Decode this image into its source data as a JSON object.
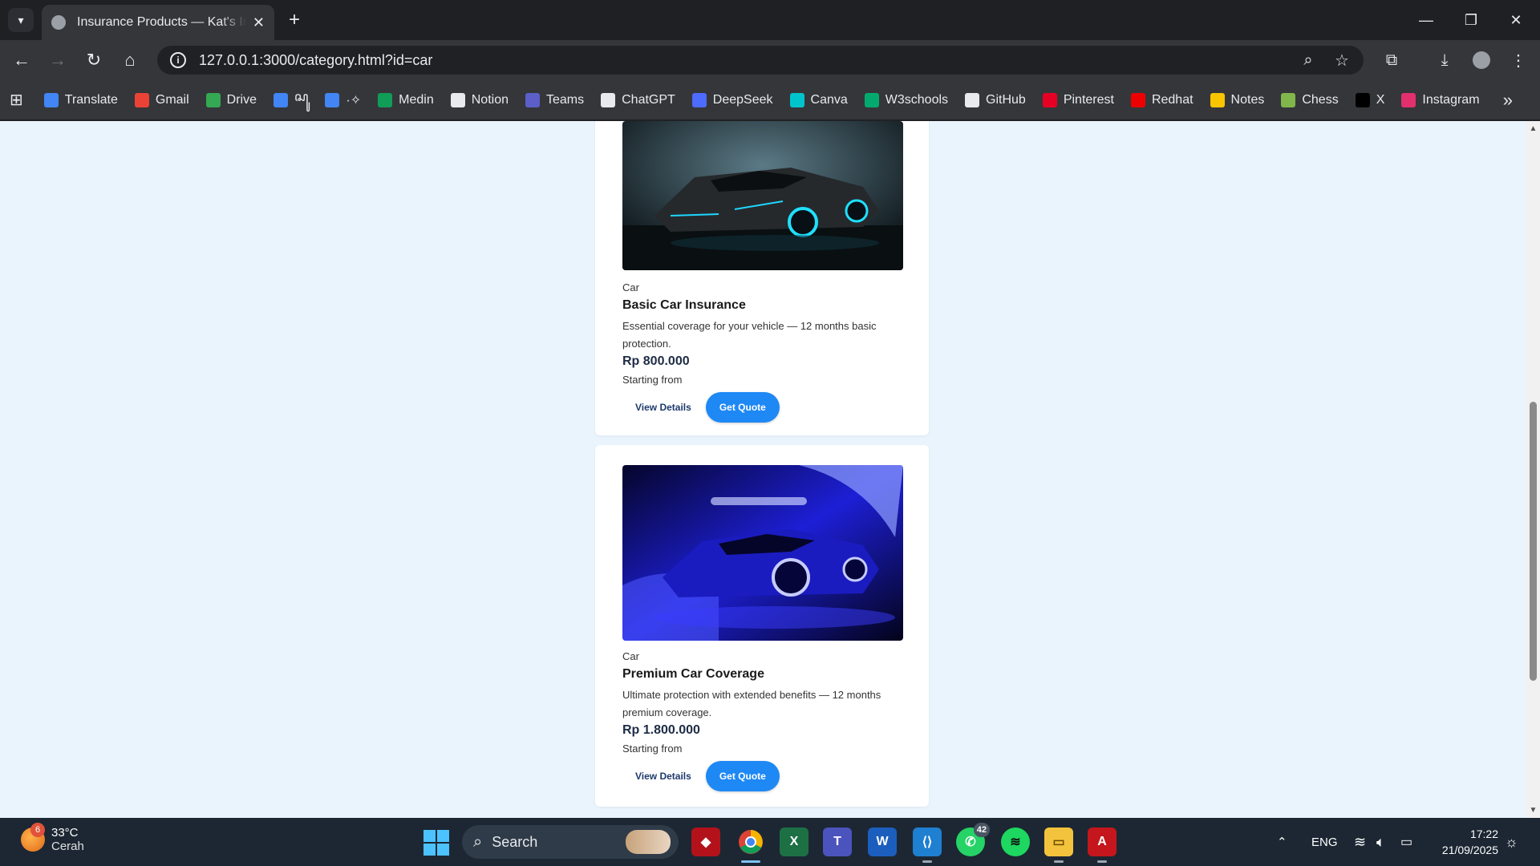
{
  "browser": {
    "tab_title": "Insurance Products — Kat's Insu",
    "url": "127.0.0.1:3000/category.html?id=car",
    "bookmarks": [
      {
        "label": "Translate",
        "icon": "translate-icon",
        "color": "#4285f4"
      },
      {
        "label": "Gmail",
        "icon": "gmail-icon",
        "color": "#ea4335"
      },
      {
        "label": "Drive",
        "icon": "drive-icon",
        "color": "#34a853"
      },
      {
        "label": "ꦱꦸ",
        "icon": "docs-icon",
        "color": "#4285f4"
      },
      {
        "label": "·✧",
        "icon": "docs-icon",
        "color": "#4285f4"
      },
      {
        "label": "Medin",
        "icon": "sheets-icon",
        "color": "#0f9d58"
      },
      {
        "label": "Notion",
        "icon": "notion-icon",
        "color": "#e8eaed"
      },
      {
        "label": "Teams",
        "icon": "teams-icon",
        "color": "#5b5fc7"
      },
      {
        "label": "ChatGPT",
        "icon": "chatgpt-icon",
        "color": "#e8eaed"
      },
      {
        "label": "DeepSeek",
        "icon": "deepseek-icon",
        "color": "#4d6bfe"
      },
      {
        "label": "Canva",
        "icon": "canva-icon",
        "color": "#00c4cc"
      },
      {
        "label": "W3schools",
        "icon": "w3schools-icon",
        "color": "#04aa6d"
      },
      {
        "label": "GitHub",
        "icon": "github-icon",
        "color": "#e8eaed"
      },
      {
        "label": "Pinterest",
        "icon": "pinterest-icon",
        "color": "#e60023"
      },
      {
        "label": "Redhat",
        "icon": "redhat-icon",
        "color": "#ee0000"
      },
      {
        "label": "Notes",
        "icon": "notes-icon",
        "color": "#f7c600"
      },
      {
        "label": "Chess",
        "icon": "chess-icon",
        "color": "#81b64c"
      },
      {
        "label": "X",
        "icon": "x-icon",
        "color": "#000000"
      },
      {
        "label": "Instagram",
        "icon": "instagram-icon",
        "color": "#e1306c"
      }
    ]
  },
  "products": [
    {
      "category": "Car",
      "name": "Basic Car Insurance",
      "description": "Essential coverage for your vehicle — 12 months basic protection.",
      "price": "Rp 800.000",
      "price_note": "Starting from",
      "details_label": "View Details",
      "quote_label": "Get Quote",
      "image_theme": "#17c3e6"
    },
    {
      "category": "Car",
      "name": "Premium Car Coverage",
      "description": "Ultimate protection with extended benefits — 12 months premium coverage.",
      "price": "Rp 1.800.000",
      "price_note": "Starting from",
      "details_label": "View Details",
      "quote_label": "Get Quote",
      "image_theme": "#2a2cff"
    }
  ],
  "taskbar": {
    "weather_temp": "33°C",
    "weather_cond": "Cerah",
    "weather_badge": "6",
    "search_label": "Search",
    "whatsapp_count": "42",
    "language": "ENG",
    "time": "17:22",
    "date": "21/09/2025"
  }
}
